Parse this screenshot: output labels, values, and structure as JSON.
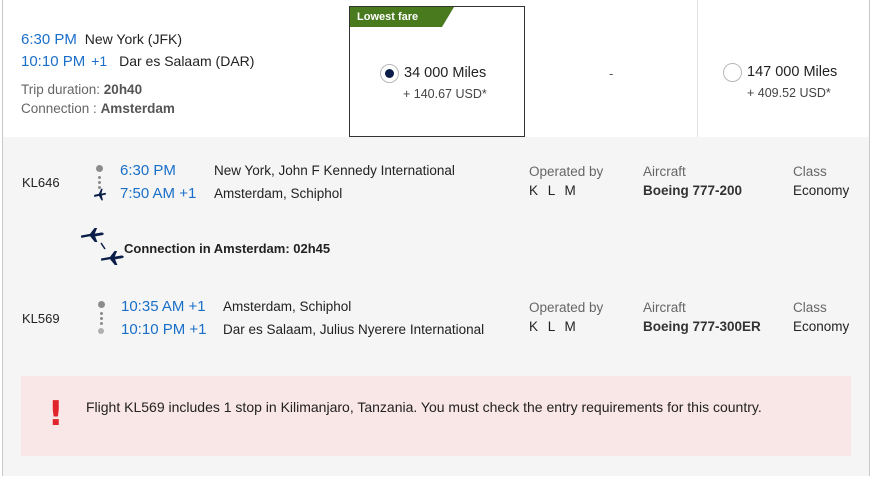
{
  "summary": {
    "departure_time": "6:30 PM",
    "departure_city": "New York (JFK)",
    "arrival_time": "10:10 PM",
    "arrival_plus": "+1",
    "arrival_city": "Dar es Salaam (DAR)",
    "duration_label": "Trip duration: ",
    "duration_value": "20h40",
    "connection_label": "Connection : ",
    "connection_value": "Amsterdam"
  },
  "fares": [
    {
      "tag": "Lowest fare",
      "miles": "34 000 Miles",
      "usd": "+ 140.67 USD*",
      "selected": true
    },
    {
      "placeholder": "-"
    },
    {
      "miles": "147 000 Miles",
      "usd": "+ 409.52 USD*",
      "selected": false
    }
  ],
  "segments": [
    {
      "flight": "KL646",
      "dep_time": "6:30 PM",
      "dep_place": "New York, John F Kennedy International",
      "arr_time": "7:50 AM +1",
      "arr_place": "Amsterdam, Schiphol",
      "operated_label": "Operated by",
      "operated_value": "K L M",
      "aircraft_label": "Aircraft",
      "aircraft_value": "Boeing 777-200",
      "class_label": "Class",
      "class_value": "Economy"
    },
    {
      "flight": "KL569",
      "dep_time": "10:35 AM +1",
      "dep_place": "Amsterdam, Schiphol",
      "arr_time": "10:10 PM +1",
      "arr_place": "Dar es Salaam, Julius Nyerere International",
      "operated_label": "Operated by",
      "operated_value": "K L M",
      "aircraft_label": "Aircraft",
      "aircraft_value": "Boeing 777-300ER",
      "class_label": "Class",
      "class_value": "Economy"
    }
  ],
  "connection": {
    "text": "Connection in Amsterdam: 02h45",
    "icon": "connection-planes-icon"
  },
  "alert": {
    "icon": "exclamation-icon",
    "text": "Flight KL569 includes 1 stop in Kilimanjaro, Tanzania. You must check the entry requirements for this country."
  },
  "colors": {
    "accent_blue": "#1a6fc9",
    "lowest_fare_green": "#4a7a1e",
    "radio_selected": "#0b1e4a",
    "alert_bg": "#f9e6e6",
    "alert_red": "#e0242a",
    "details_bg": "#f4f5f4"
  }
}
